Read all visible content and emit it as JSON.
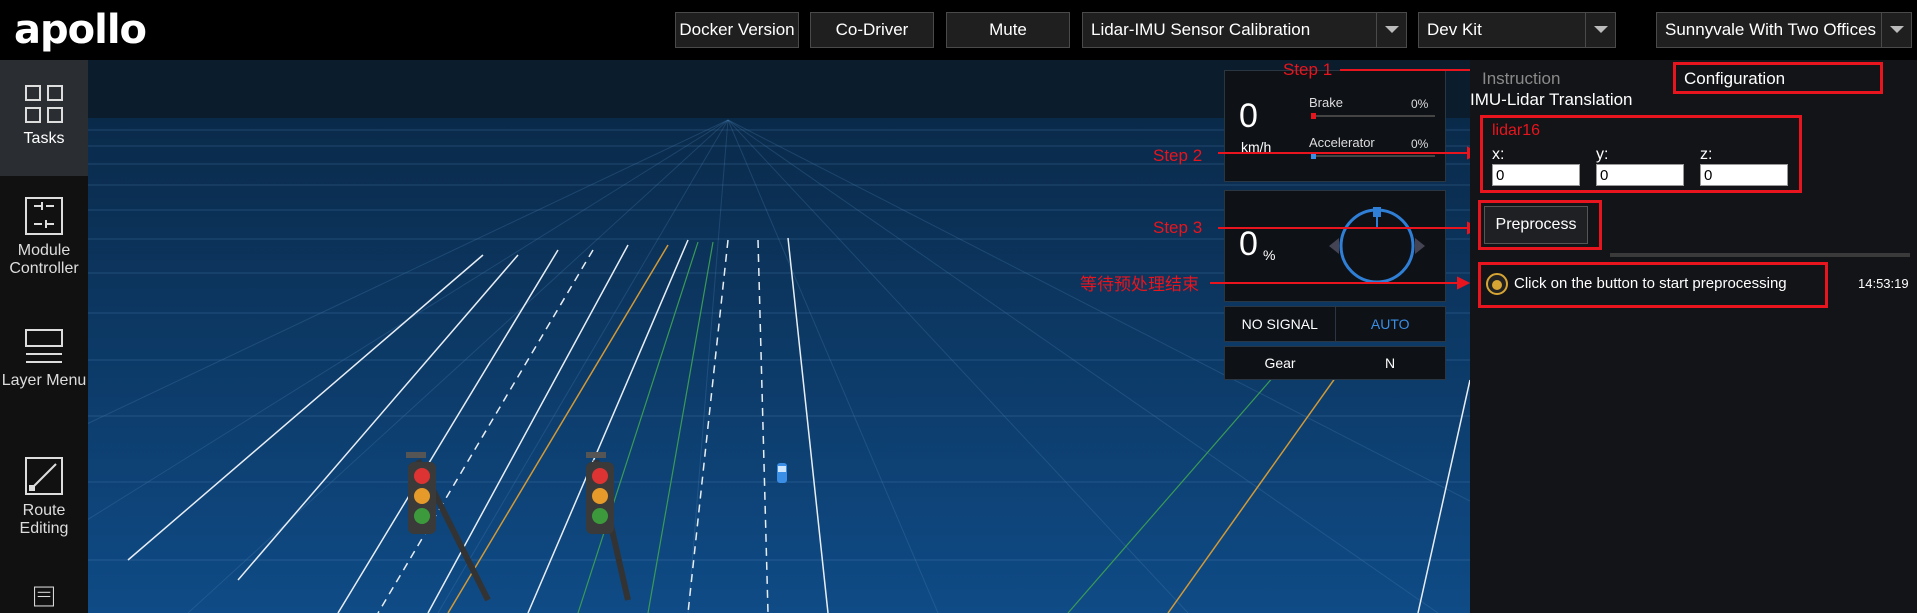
{
  "header": {
    "logo": "apollo",
    "docker_version_label": "Docker Version",
    "co_driver_label": "Co-Driver",
    "mute_label": "Mute",
    "mode_select": "Lidar-IMU Sensor Calibration",
    "vehicle_select": "Dev Kit",
    "map_select": "Sunnyvale With Two Offices"
  },
  "sidebar": {
    "items": [
      {
        "label": "Tasks",
        "icon": "grid-icon"
      },
      {
        "label": "Module Controller",
        "icon": "sliders-icon"
      },
      {
        "label": "Layer Menu",
        "icon": "layers-icon"
      },
      {
        "label": "Route Editing",
        "icon": "route-icon"
      },
      {
        "label": "",
        "icon": "list-icon"
      }
    ]
  },
  "dashboard": {
    "speed_value": "0",
    "speed_unit": "km/h",
    "brake_label": "Brake",
    "brake_pct": "0%",
    "accel_label": "Accelerator",
    "accel_pct": "0%",
    "steering_value": "0",
    "steering_unit": "%",
    "signal_label": "NO SIGNAL",
    "drive_mode": "AUTO",
    "gear_label": "Gear",
    "gear_value": "N"
  },
  "panel": {
    "tab_instruction": "Instruction",
    "tab_configuration": "Configuration",
    "section_title": "IMU-Lidar Translation",
    "sensor_name": "lidar16",
    "x_label": "x:",
    "y_label": "y:",
    "z_label": "z:",
    "x_value": "0",
    "y_value": "0",
    "z_value": "0",
    "preprocess_label": "Preprocess",
    "status_message": "Click on the button to start preprocessing",
    "status_time": "14:53:19"
  },
  "annotations": {
    "step1": "Step 1",
    "step2": "Step 2",
    "step3": "Step 3",
    "wait_note": "等待预处理结束"
  },
  "colors": {
    "accent_red": "#e8141e",
    "scene_sky": "#0b1d2c",
    "scene_ground": "#0d3a66",
    "auto_blue": "#3a8ee6"
  }
}
